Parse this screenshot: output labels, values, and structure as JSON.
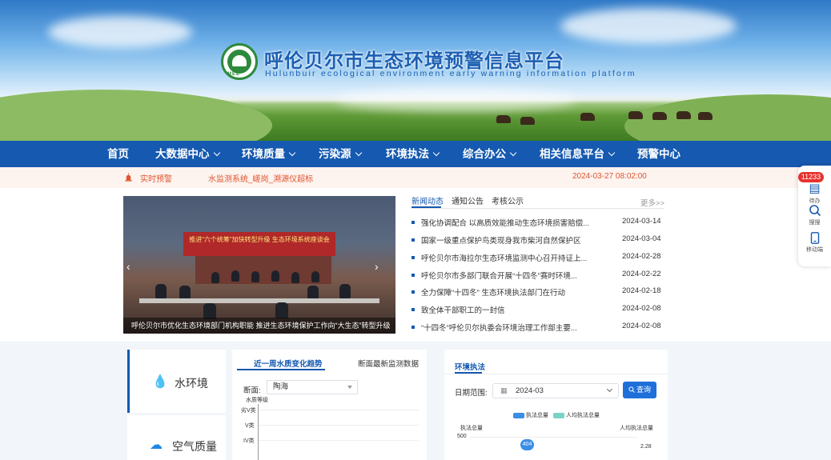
{
  "header": {
    "title": "呼伦贝尔市生态环境预警信息平台",
    "subtitle": "Hulunbuir ecological environment early warning information platform",
    "logo_text": "MEE"
  },
  "nav": {
    "items": [
      {
        "label": "首页",
        "has_dropdown": false
      },
      {
        "label": "大数据中心",
        "has_dropdown": true
      },
      {
        "label": "环境质量",
        "has_dropdown": true
      },
      {
        "label": "污染源",
        "has_dropdown": true
      },
      {
        "label": "环境执法",
        "has_dropdown": true
      },
      {
        "label": "综合办公",
        "has_dropdown": true
      },
      {
        "label": "相关信息平台",
        "has_dropdown": true
      },
      {
        "label": "预警中心",
        "has_dropdown": false
      }
    ]
  },
  "alert": {
    "label": "实时预警",
    "message": "水监测系统_嵯岗_溯源仪超标",
    "time": "2024-03-27 08:02:00"
  },
  "carousel": {
    "banner_text": "推进“六个统筹”加快转型升级 生态环境系统座谈会",
    "caption": "呼伦贝尔市优化生态环境部门机构职能 推进生态环境保护工作向“大生态”转型升级",
    "prev": "‹",
    "next": "›"
  },
  "news": {
    "tabs": [
      "新闻动态",
      "通知公告",
      "考核公示"
    ],
    "more": "更多>>",
    "items": [
      {
        "title": "强化协调配合 以高质效能推动生态环境损害赔偿...",
        "date": "2024-03-14"
      },
      {
        "title": "国家一级重点保护鸟类现身我市柴河自然保护区",
        "date": "2024-03-04"
      },
      {
        "title": "呼伦贝尔市海拉尔生态环境监测中心召开持证上...",
        "date": "2024-02-28"
      },
      {
        "title": "呼伦贝尔市多部门联合开展“十四冬”赛时环境...",
        "date": "2024-02-22"
      },
      {
        "title": "全力保障“十四冬” 生态环境执法部门在行动",
        "date": "2024-02-18"
      },
      {
        "title": "致全体干部职工的一封信",
        "date": "2024-02-08"
      },
      {
        "title": "“十四冬”呼伦贝尔执委会环境治理工作部主要...",
        "date": "2024-02-08"
      }
    ]
  },
  "float_bar": {
    "badge": "11233",
    "items": [
      {
        "label": "待办",
        "icon": "clipboard-icon"
      },
      {
        "label": "搜搜",
        "icon": "search-icon"
      },
      {
        "label": "移动端",
        "icon": "mobile-icon"
      }
    ]
  },
  "side_menu": {
    "items": [
      {
        "label": "水环境",
        "icon": "water-icon",
        "icon_glyph": "💧"
      },
      {
        "label": "空气质量",
        "icon": "cloud-icon",
        "icon_glyph": "☁"
      }
    ]
  },
  "water_panel": {
    "tabs": [
      "近一周水质变化趋势",
      "断面最新监测数据"
    ],
    "section_label": "断面:",
    "section_value": "陶海",
    "y_title": "水质等级",
    "y_ticks": [
      "劣V类",
      "V类",
      "IV类"
    ]
  },
  "enforcement_panel": {
    "title": "环境执法",
    "date_label": "日期范围:",
    "date_value": "2024-03",
    "query_button": "查询",
    "legend": [
      {
        "name": "执法总量",
        "color": "#3a8ee6"
      },
      {
        "name": "人均执法总量",
        "color": "#7ad3c8"
      }
    ],
    "left_axis_title": "执法总量",
    "right_axis_title": "人均执法总量",
    "left_tick": "500",
    "right_tick": "2.28",
    "bar_value": "404"
  },
  "colors": {
    "primary": "#1559b0",
    "alert": "#e0552f",
    "badge": "#e5322d"
  }
}
